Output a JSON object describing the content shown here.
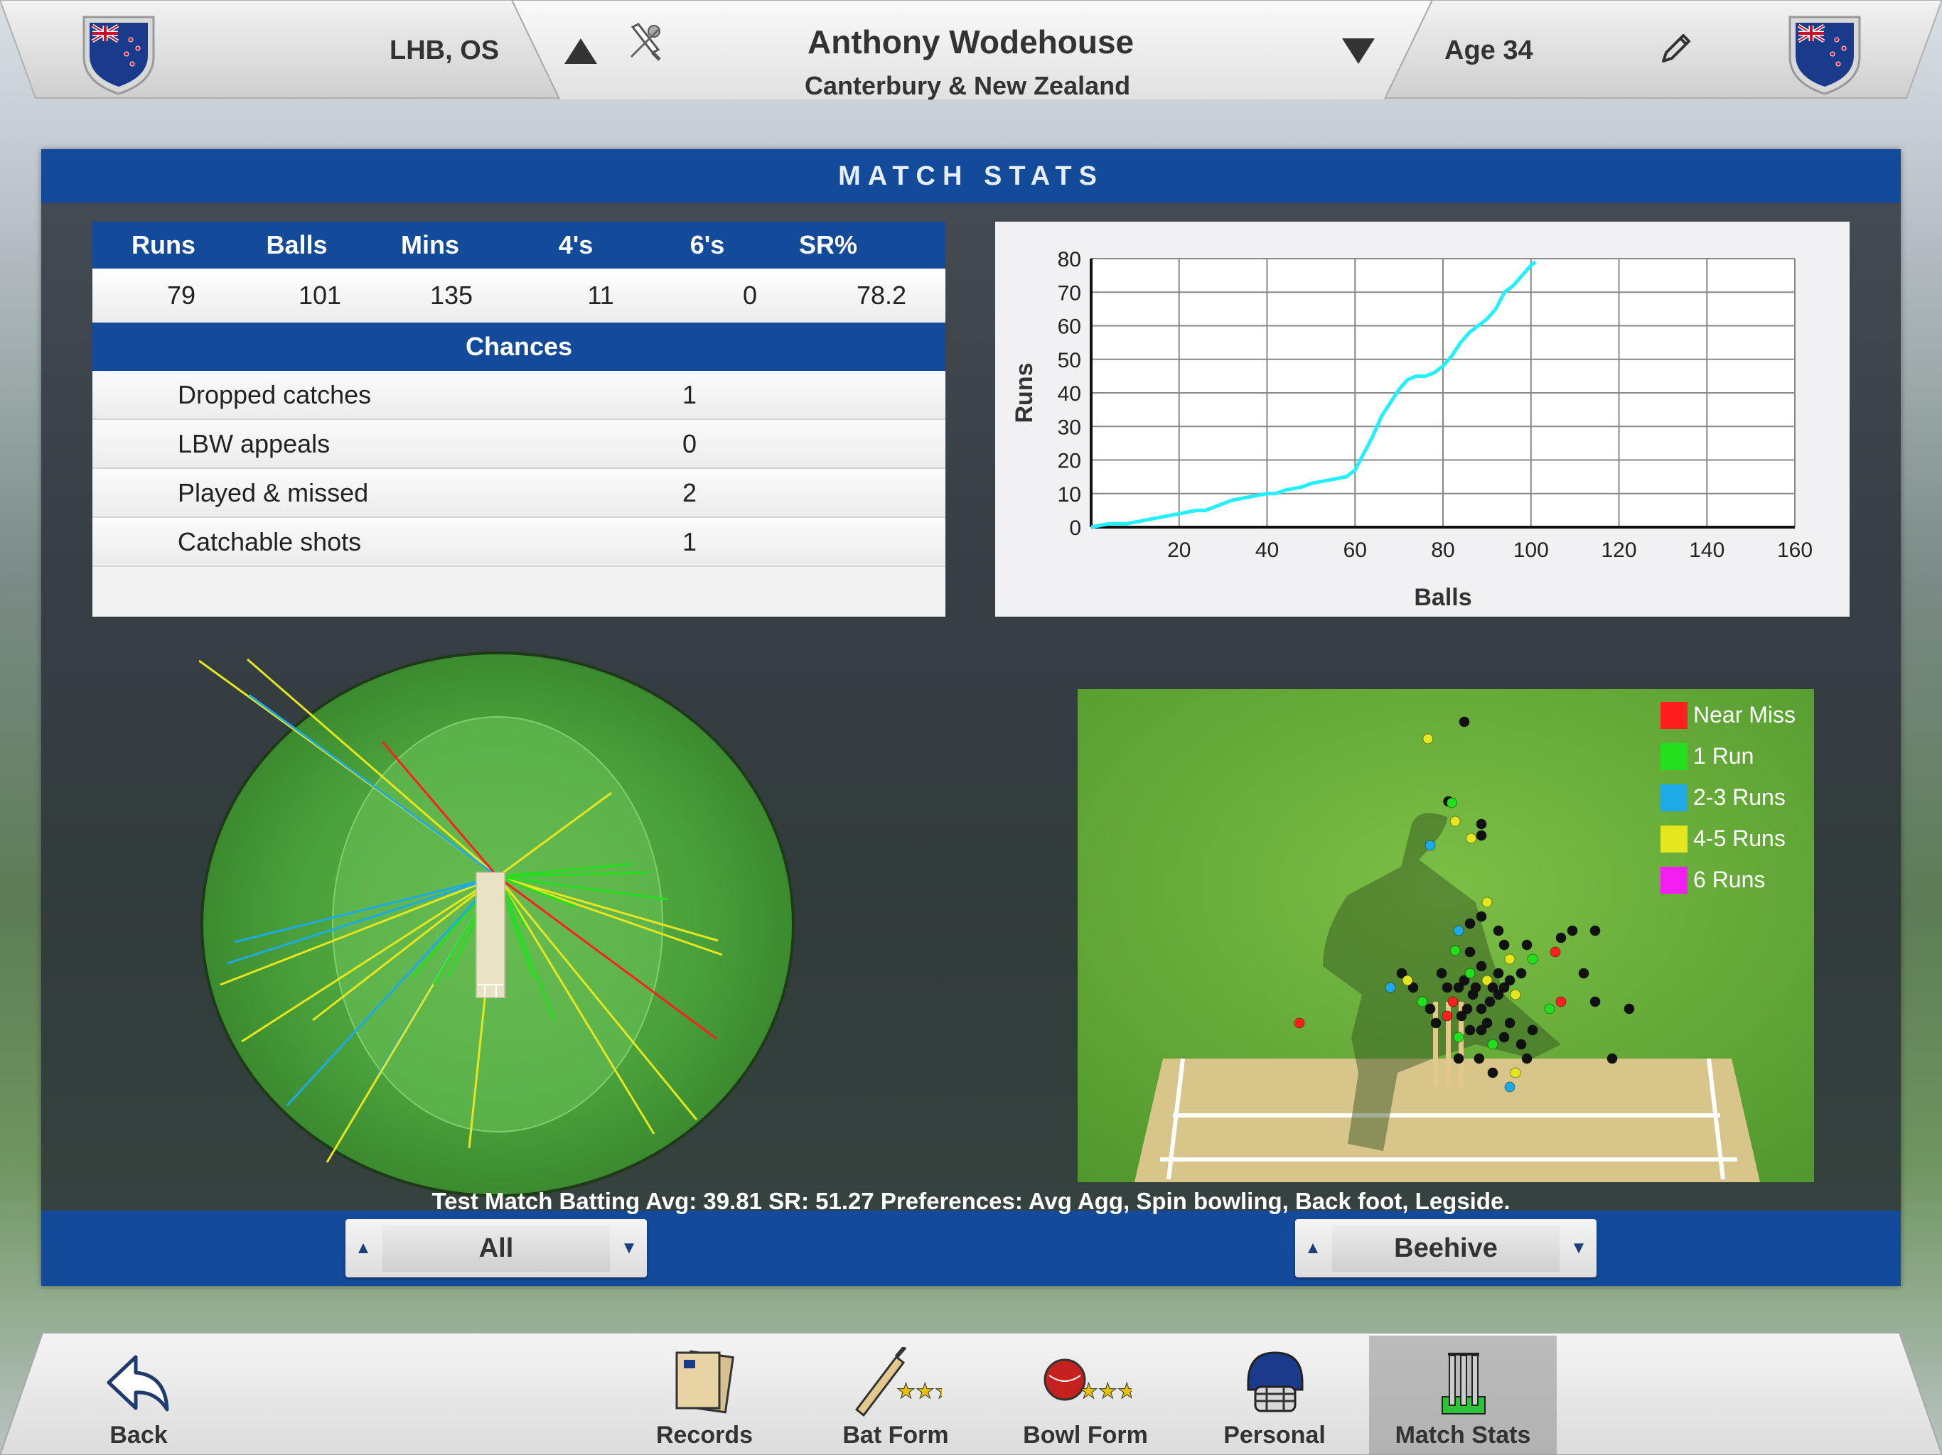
{
  "header": {
    "hand_style": "LHB, OS",
    "player_name": "Anthony Wodehouse",
    "team": "Canterbury & New Zealand",
    "age": "Age 34",
    "icons": [
      "nz-flag-shield-icon",
      "up-triangle-icon",
      "bat-ball-icon",
      "down-triangle-icon",
      "pencil-icon"
    ]
  },
  "panel": {
    "title": "MATCH STATS"
  },
  "batting": {
    "headers": [
      "Runs",
      "Balls",
      "Mins",
      "4's",
      "6's",
      "SR%"
    ],
    "values": [
      "79",
      "101",
      "135",
      "11",
      "0",
      "78.2"
    ]
  },
  "chances": {
    "title": "Chances",
    "rows": [
      {
        "label": "Dropped catches",
        "value": "1"
      },
      {
        "label": "LBW appeals",
        "value": "0"
      },
      {
        "label": "Played & missed",
        "value": "2"
      },
      {
        "label": "Catchable shots",
        "value": "1"
      }
    ]
  },
  "chart_data": {
    "type": "line",
    "xlabel": "Balls",
    "ylabel": "Runs",
    "xlim": [
      0,
      160
    ],
    "ylim": [
      0,
      80
    ],
    "x_ticks": [
      20,
      40,
      60,
      80,
      100,
      120,
      140,
      160
    ],
    "y_ticks": [
      0,
      10,
      20,
      30,
      40,
      50,
      60,
      70,
      80
    ],
    "grid": true,
    "line_color": "#22f0ff",
    "x": [
      0,
      4,
      8,
      12,
      16,
      20,
      24,
      26,
      28,
      30,
      32,
      36,
      40,
      42,
      44,
      48,
      50,
      54,
      58,
      60,
      62,
      64,
      66,
      68,
      70,
      72,
      74,
      76,
      78,
      80,
      82,
      84,
      86,
      88,
      90,
      92,
      94,
      96,
      98,
      100,
      101
    ],
    "y": [
      0,
      1,
      1,
      2,
      3,
      4,
      5,
      5,
      6,
      7,
      8,
      9,
      10,
      10,
      11,
      12,
      13,
      14,
      15,
      17,
      22,
      27,
      33,
      37,
      41,
      44,
      45,
      45,
      46,
      48,
      51,
      55,
      58,
      60,
      62,
      65,
      70,
      72,
      75,
      78,
      79
    ]
  },
  "legend": [
    {
      "label": "Near Miss",
      "color": "#ff1e1e"
    },
    {
      "label": "1 Run",
      "color": "#22e01e"
    },
    {
      "label": "2-3 Runs",
      "color": "#1eaae6"
    },
    {
      "label": "4-5 Runs",
      "color": "#e6e61e"
    },
    {
      "label": "6 Runs",
      "color": "#f21ef2"
    }
  ],
  "summary": "Test Match Batting Avg: 39.81    SR: 51.27    Preferences: Avg Agg, Spin bowling, Back foot, Legside.",
  "selectors": {
    "left": "All",
    "right": "Beehive"
  },
  "nav": {
    "back": "Back",
    "tabs": [
      "Records",
      "Bat Form",
      "Bowl Form",
      "Personal",
      "Match Stats"
    ],
    "active": "Match Stats"
  }
}
